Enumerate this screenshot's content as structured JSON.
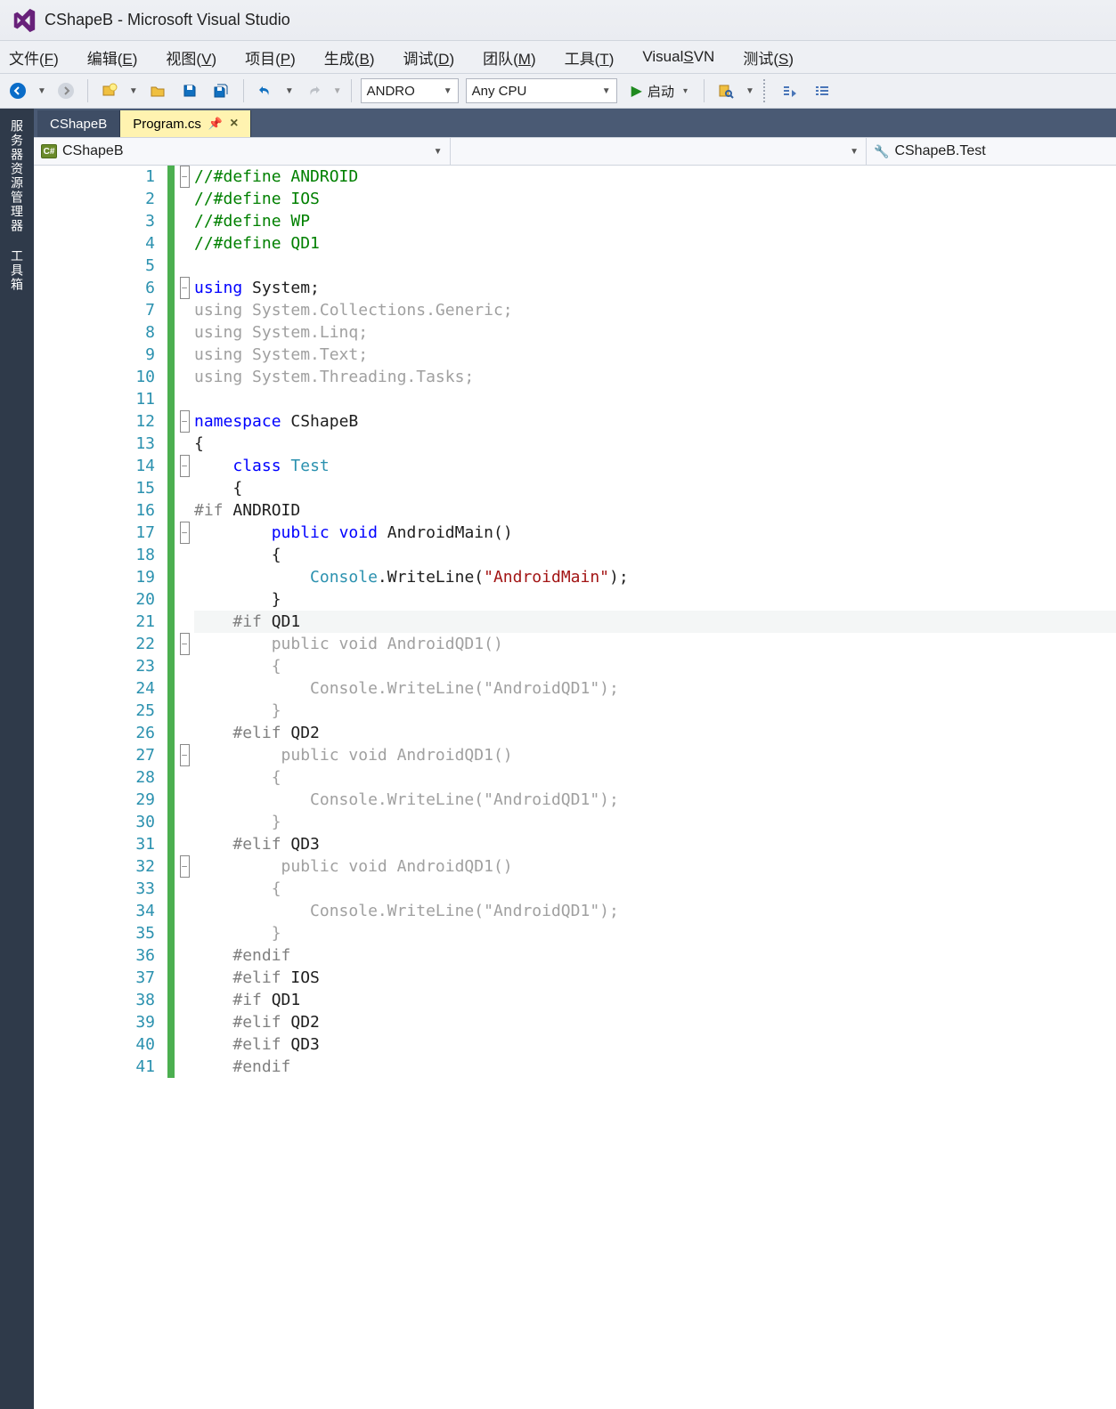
{
  "title": "CShapeB - Microsoft Visual Studio",
  "menu": {
    "file": "文件(F)",
    "edit": "编辑(E)",
    "view": "视图(V)",
    "project": "项目(P)",
    "build": "生成(B)",
    "debug": "调试(D)",
    "team": "团队(M)",
    "tools": "工具(T)",
    "visualsvn": "VisualSVN",
    "test": "测试(S)"
  },
  "toolbar": {
    "config": "ANDRO",
    "platform": "Any CPU",
    "start": "启动"
  },
  "side_tabs": {
    "server_explorer": "服务器资源管理器",
    "toolbox": "工具箱"
  },
  "doc_tabs": {
    "project": "CShapeB",
    "file": "Program.cs"
  },
  "nav": {
    "project": "CShapeB",
    "member": "CShapeB.Test"
  },
  "code": {
    "lines": [
      {
        "n": 1,
        "fold": "-",
        "g": 1,
        "html": "<span class='c-comment'>//#define ANDROID</span>"
      },
      {
        "n": 2,
        "fold": "",
        "g": 1,
        "html": "<span class='c-comment'>//#define IOS</span>"
      },
      {
        "n": 3,
        "fold": "",
        "g": 1,
        "html": "<span class='c-comment'>//#define WP</span>"
      },
      {
        "n": 4,
        "fold": "",
        "g": 1,
        "html": "<span class='c-comment'>//#define QD1</span>"
      },
      {
        "n": 5,
        "fold": "",
        "g": 1,
        "html": ""
      },
      {
        "n": 6,
        "fold": "-",
        "g": 1,
        "html": "<span class='c-key'>using</span> System;"
      },
      {
        "n": 7,
        "fold": "",
        "g": 1,
        "html": "<span class='c-dim'>using System.Collections.Generic;</span>"
      },
      {
        "n": 8,
        "fold": "",
        "g": 1,
        "html": "<span class='c-dim'>using System.Linq;</span>"
      },
      {
        "n": 9,
        "fold": "",
        "g": 1,
        "html": "<span class='c-dim'>using System.Text;</span>"
      },
      {
        "n": 10,
        "fold": "",
        "g": 1,
        "html": "<span class='c-dim'>using System.Threading.Tasks;</span>"
      },
      {
        "n": 11,
        "fold": "",
        "g": 1,
        "html": ""
      },
      {
        "n": 12,
        "fold": "-",
        "g": 1,
        "html": "<span class='c-key'>namespace</span> CShapeB"
      },
      {
        "n": 13,
        "fold": "",
        "g": 1,
        "html": "{"
      },
      {
        "n": 14,
        "fold": "-",
        "g": 1,
        "html": "    <span class='c-key'>class</span> <span class='c-type'>Test</span>"
      },
      {
        "n": 15,
        "fold": "",
        "g": 1,
        "html": "    {"
      },
      {
        "n": 16,
        "fold": "",
        "g": 1,
        "html": "<span class='c-pp'>#if</span> ANDROID"
      },
      {
        "n": 17,
        "fold": "-",
        "g": 1,
        "html": "        <span class='c-key'>public</span> <span class='c-key'>void</span> AndroidMain()"
      },
      {
        "n": 18,
        "fold": "",
        "g": 1,
        "html": "        {"
      },
      {
        "n": 19,
        "fold": "",
        "g": 1,
        "html": "            <span class='c-type'>Console</span>.WriteLine(<span class='c-str'>&quot;AndroidMain&quot;</span>);"
      },
      {
        "n": 20,
        "fold": "",
        "g": 1,
        "html": "        }"
      },
      {
        "n": 21,
        "fold": "",
        "g": 1,
        "hl": 1,
        "html": "    <span class='c-pp'>#if</span> QD1"
      },
      {
        "n": 22,
        "fold": "-",
        "g": 1,
        "html": "<span class='c-dim'>        public void AndroidQD1()</span>"
      },
      {
        "n": 23,
        "fold": "",
        "g": 1,
        "html": "<span class='c-dim'>        {</span>"
      },
      {
        "n": 24,
        "fold": "",
        "g": 1,
        "html": "<span class='c-dim'>            Console.WriteLine(&quot;AndroidQD1&quot;);</span>"
      },
      {
        "n": 25,
        "fold": "",
        "g": 1,
        "html": "<span class='c-dim'>        }</span>"
      },
      {
        "n": 26,
        "fold": "",
        "g": 1,
        "html": "    <span class='c-pp'>#elif</span> QD2"
      },
      {
        "n": 27,
        "fold": "-",
        "g": 1,
        "html": "<span class='c-dim'>         public void AndroidQD1()</span>"
      },
      {
        "n": 28,
        "fold": "",
        "g": 1,
        "html": "<span class='c-dim'>        {</span>"
      },
      {
        "n": 29,
        "fold": "",
        "g": 1,
        "html": "<span class='c-dim'>            Console.WriteLine(&quot;AndroidQD1&quot;);</span>"
      },
      {
        "n": 30,
        "fold": "",
        "g": 1,
        "html": "<span class='c-dim'>        }</span>"
      },
      {
        "n": 31,
        "fold": "",
        "g": 1,
        "html": "    <span class='c-pp'>#elif</span> QD3"
      },
      {
        "n": 32,
        "fold": "-",
        "g": 1,
        "html": "<span class='c-dim'>         public void AndroidQD1()</span>"
      },
      {
        "n": 33,
        "fold": "",
        "g": 1,
        "html": "<span class='c-dim'>        {</span>"
      },
      {
        "n": 34,
        "fold": "",
        "g": 1,
        "html": "<span class='c-dim'>            Console.WriteLine(&quot;AndroidQD1&quot;);</span>"
      },
      {
        "n": 35,
        "fold": "",
        "g": 1,
        "html": "<span class='c-dim'>        }</span>"
      },
      {
        "n": 36,
        "fold": "",
        "g": 1,
        "html": "    <span class='c-pp'>#endif</span>"
      },
      {
        "n": 37,
        "fold": "",
        "g": 1,
        "html": "    <span class='c-pp'>#elif</span> IOS"
      },
      {
        "n": 38,
        "fold": "",
        "g": 1,
        "html": "    <span class='c-pp'>#if</span> QD1"
      },
      {
        "n": 39,
        "fold": "",
        "g": 1,
        "html": "    <span class='c-pp'>#elif</span> QD2"
      },
      {
        "n": 40,
        "fold": "",
        "g": 1,
        "html": "    <span class='c-pp'>#elif</span> QD3"
      },
      {
        "n": 41,
        "fold": "",
        "g": 1,
        "html": "    <span class='c-pp'>#endif</span>"
      }
    ]
  }
}
